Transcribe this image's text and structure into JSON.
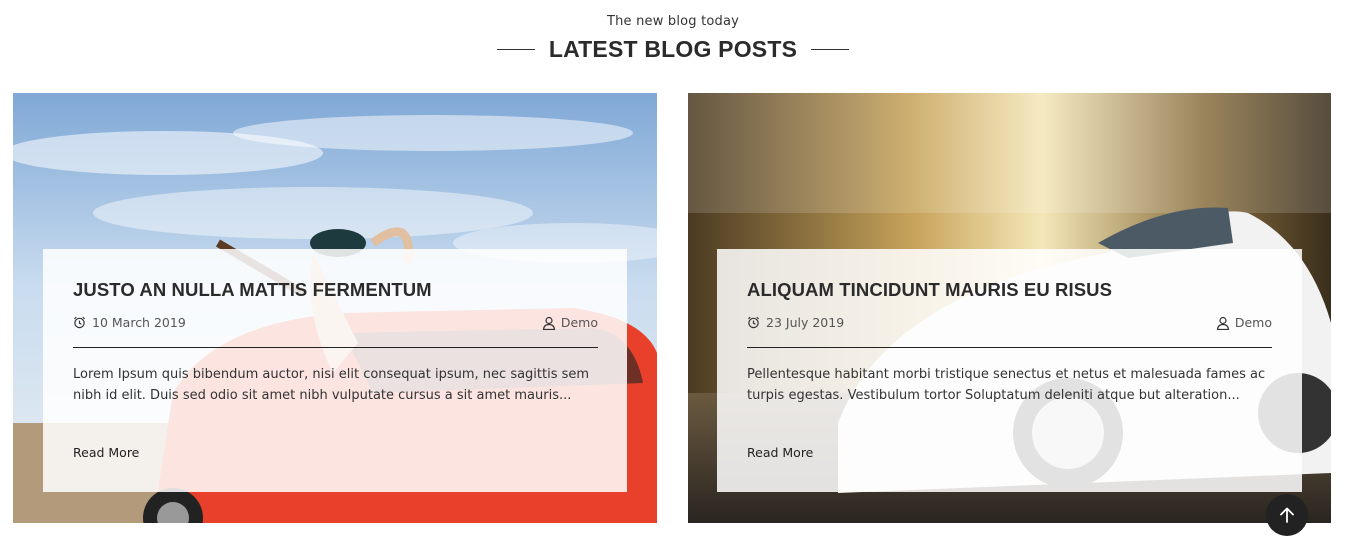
{
  "section": {
    "subtitle": "The new blog today",
    "title": "LATEST BLOG POSTS"
  },
  "posts": [
    {
      "title": "JUSTO AN NULLA MATTIS FERMENTUM",
      "date": "10 March 2019",
      "author": "Demo",
      "excerpt": "Lorem Ipsum quis bibendum auctor, nisi elit consequat ipsum, nec sagittis sem nibh id elit. Duis sed odio sit amet nibh vulputate cursus a sit amet mauris...",
      "read_more": "Read More",
      "image_icon": "woman-with-guitar-red-car-photo"
    },
    {
      "title": "ALIQUAM TINCIDUNT MAURIS EU RISUS",
      "date": "23 July 2019",
      "author": "Demo",
      "excerpt": "Pellentesque habitant morbi tristique senectus et netus et malesuada fames ac turpis egestas. Vestibulum tortor Soluptatum deleniti atque but alteration...",
      "read_more": "Read More",
      "image_icon": "white-car-motion-blur-photo"
    }
  ],
  "scroll_top": {
    "icon": "arrow-up-icon"
  },
  "colors": {
    "dark": "#222222",
    "car_red": "#e8402a",
    "sky": "#a9c8e6"
  }
}
